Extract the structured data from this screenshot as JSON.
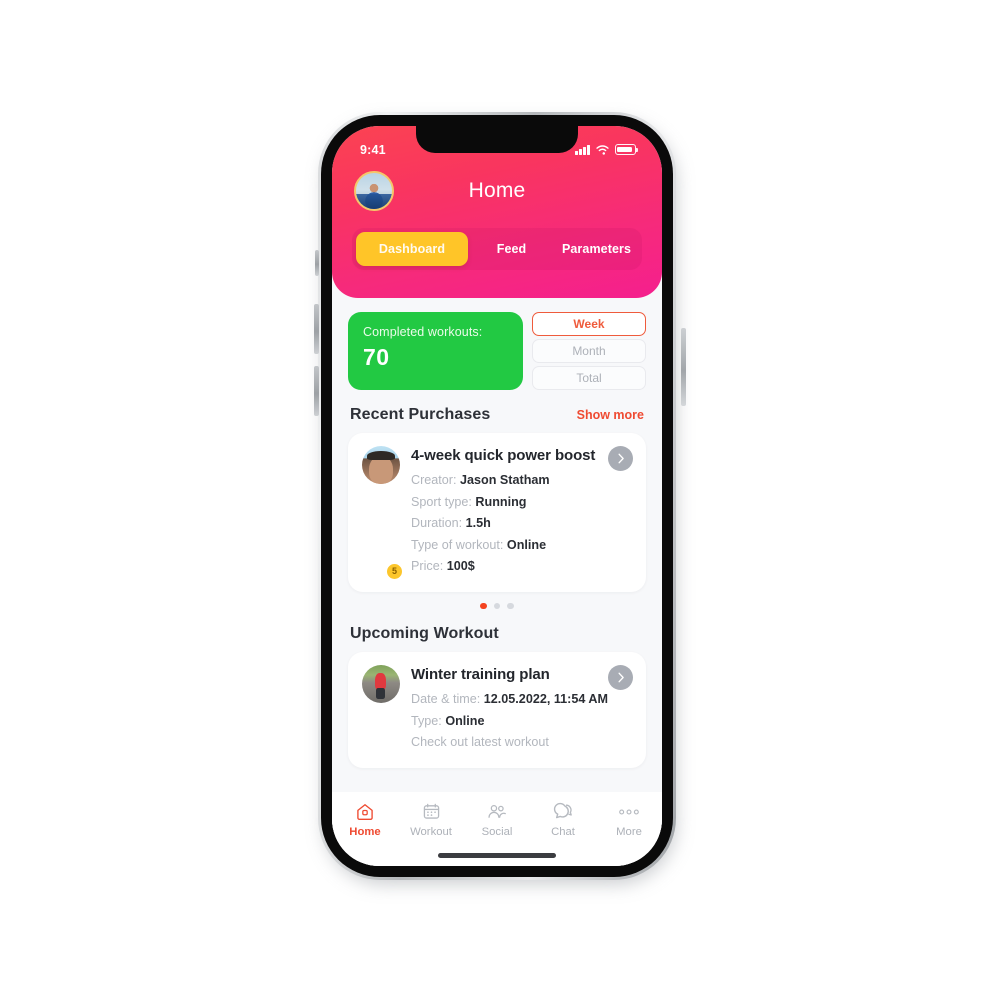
{
  "status_bar": {
    "time": "9:41",
    "signal_icon": "cellular-signal-icon",
    "wifi_icon": "wifi-icon",
    "battery_icon": "battery-icon"
  },
  "header": {
    "title": "Home",
    "avatar_name": "user-avatar",
    "gradient_from": "#fb4352",
    "gradient_to": "#f51f8e",
    "tabs": [
      {
        "label": "Dashboard",
        "active": true
      },
      {
        "label": "Feed",
        "active": false
      },
      {
        "label": "Parameters",
        "active": false
      }
    ],
    "active_tab_color": "#ffc528"
  },
  "stats": {
    "label": "Completed workouts:",
    "value": "70",
    "card_color": "#22c943",
    "periods": [
      {
        "label": "Week",
        "active": true
      },
      {
        "label": "Month",
        "active": false
      },
      {
        "label": "Total",
        "active": false
      }
    ],
    "active_period_color": "#ef5b3c"
  },
  "recent_purchases": {
    "title": "Recent Purchases",
    "link": "Show more",
    "link_color": "#ef4b32",
    "card": {
      "title": "4-week quick power boost",
      "rating_badge": "5",
      "rows": [
        {
          "label": "Creator:",
          "value": "Jason Statham"
        },
        {
          "label": "Sport type:",
          "value": "Running"
        },
        {
          "label": "Duration:",
          "value": "1.5h"
        },
        {
          "label": "Type of workout:",
          "value": "Online"
        },
        {
          "label": "Price:",
          "value": "100$"
        }
      ],
      "chevron_icon": "chevron-right-icon"
    },
    "carousel": {
      "total": 3,
      "active_index": 0,
      "active_color": "#f4431f"
    }
  },
  "upcoming_workout": {
    "title": "Upcoming Workout",
    "card": {
      "title": "Winter training plan",
      "rows": [
        {
          "label": "Date & time:",
          "value": "12.05.2022, 11:54 AM"
        },
        {
          "label": "Type:",
          "value": "Online"
        }
      ],
      "footer": "Check out latest workout",
      "chevron_icon": "chevron-right-icon"
    }
  },
  "tab_bar": {
    "items": [
      {
        "label": "Home",
        "icon": "home-icon",
        "active": true
      },
      {
        "label": "Workout",
        "icon": "calendar-icon",
        "active": false
      },
      {
        "label": "Social",
        "icon": "people-icon",
        "active": false
      },
      {
        "label": "Chat",
        "icon": "chat-bubble-icon",
        "active": false
      },
      {
        "label": "More",
        "icon": "ellipsis-icon",
        "active": false
      }
    ],
    "active_color": "#ef4b32"
  }
}
